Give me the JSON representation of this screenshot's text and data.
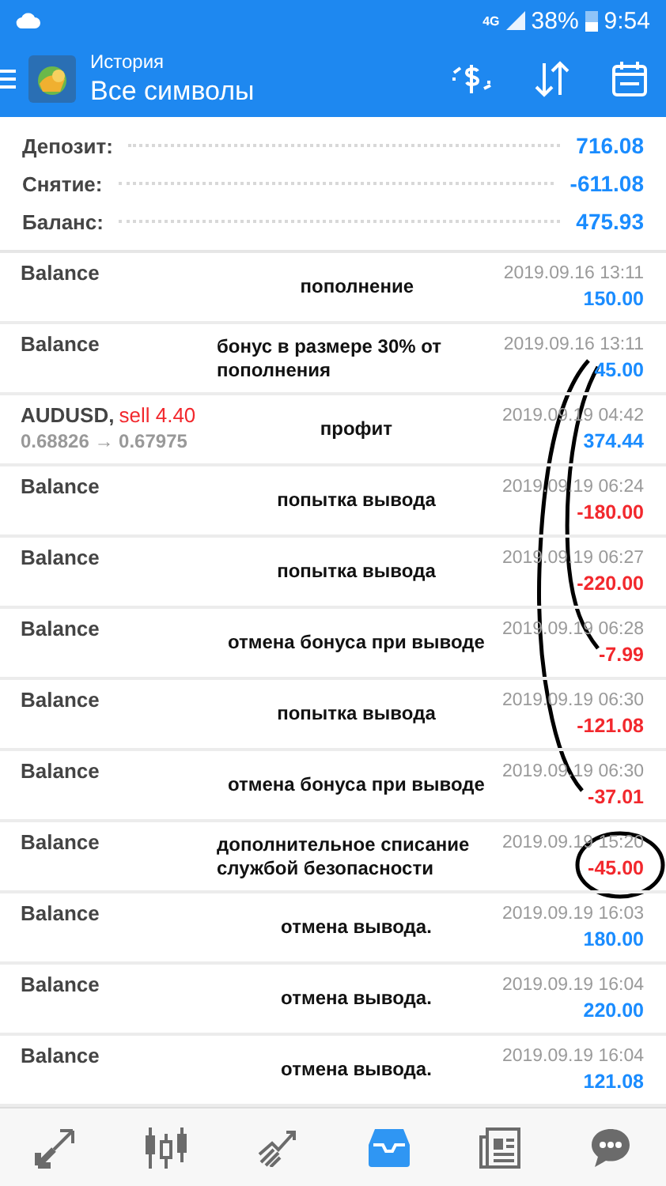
{
  "status_bar": {
    "network": "4G",
    "battery": "38%",
    "time": "9:54"
  },
  "header": {
    "subtitle": "История",
    "title": "Все символы"
  },
  "summary": [
    {
      "label": "Депозит:",
      "value": "716.08"
    },
    {
      "label": "Снятие:",
      "value": "-611.08"
    },
    {
      "label": "Баланс:",
      "value": "475.93"
    }
  ],
  "rows": [
    {
      "kind": "balance",
      "title": "Balance",
      "note": "пополнение",
      "date": "2019.09.16 13:11",
      "amount": "150.00",
      "color": "#1a8cff"
    },
    {
      "kind": "balance",
      "title": "Balance",
      "note": "бонус в размере 30% от пополнения",
      "date": "2019.09.16 13:11",
      "amount": "45.00",
      "color": "#1a8cff"
    },
    {
      "kind": "trade",
      "title": "AUDUSD,",
      "side": "sell 4.40",
      "prices": "0.68826 → 0.67975",
      "note": "профит",
      "date": "2019.09.19 04:42",
      "amount": "374.44",
      "color": "#1a8cff"
    },
    {
      "kind": "balance",
      "title": "Balance",
      "note": "попытка вывода",
      "date": "2019.09.19 06:24",
      "amount": "-180.00",
      "color": "#f2282d"
    },
    {
      "kind": "balance",
      "title": "Balance",
      "note": "попытка вывода",
      "date": "2019.09.19 06:27",
      "amount": "-220.00",
      "color": "#f2282d"
    },
    {
      "kind": "balance",
      "title": "Balance",
      "note": "отмена бонуса при выводе",
      "date": "2019.09.19 06:28",
      "amount": "-7.99",
      "color": "#f2282d"
    },
    {
      "kind": "balance",
      "title": "Balance",
      "note": "попытка вывода",
      "date": "2019.09.19 06:30",
      "amount": "-121.08",
      "color": "#f2282d"
    },
    {
      "kind": "balance",
      "title": "Balance",
      "note": "отмена бонуса при выводе",
      "date": "2019.09.19 06:30",
      "amount": "-37.01",
      "color": "#f2282d"
    },
    {
      "kind": "balance",
      "title": "Balance",
      "note": "дополнительное списание службой безопасности",
      "date": "2019.09.19 15:20",
      "amount": "-45.00",
      "color": "#f2282d"
    },
    {
      "kind": "balance",
      "title": "Balance",
      "note": "отмена вывода.",
      "date": "2019.09.19 16:03",
      "amount": "180.00",
      "color": "#1a8cff"
    },
    {
      "kind": "balance",
      "title": "Balance",
      "note": "отмена вывода.",
      "date": "2019.09.19 16:04",
      "amount": "220.00",
      "color": "#1a8cff"
    },
    {
      "kind": "balance",
      "title": "Balance",
      "note": "отмена вывода.",
      "date": "2019.09.19 16:04",
      "amount": "121.08",
      "color": "#1a8cff"
    }
  ],
  "bottom_nav": [
    {
      "kind": "quotes",
      "selected": false
    },
    {
      "kind": "chart",
      "selected": false
    },
    {
      "kind": "trade",
      "selected": false
    },
    {
      "kind": "history",
      "selected": true
    },
    {
      "kind": "news",
      "selected": false
    },
    {
      "kind": "chat",
      "selected": false
    }
  ]
}
